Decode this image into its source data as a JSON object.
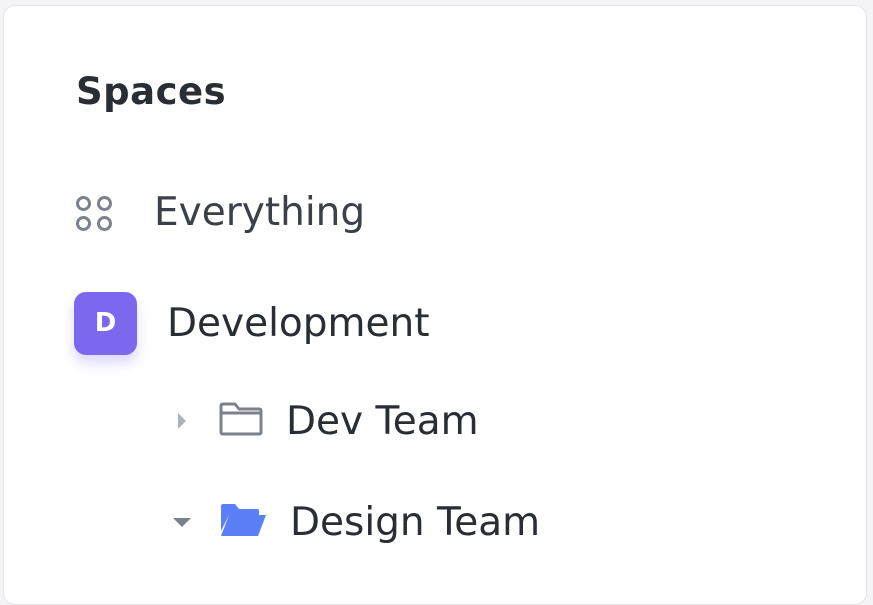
{
  "sidebar": {
    "heading": "Spaces",
    "items": [
      {
        "label": "Everything",
        "icon": "grid-dots-icon"
      },
      {
        "label": "Development",
        "avatar_letter": "D",
        "avatar_color": "#7b68ee"
      },
      {
        "label": "Dev Team",
        "icon": "folder-outline-icon",
        "expanded": false
      },
      {
        "label": "Design Team",
        "icon": "folder-open-icon",
        "expanded": true
      }
    ]
  },
  "colors": {
    "text": "#292d34",
    "icon_gray": "#7c828d",
    "folder_blue": "#5b7ff7",
    "avatar_purple": "#7b68ee"
  }
}
